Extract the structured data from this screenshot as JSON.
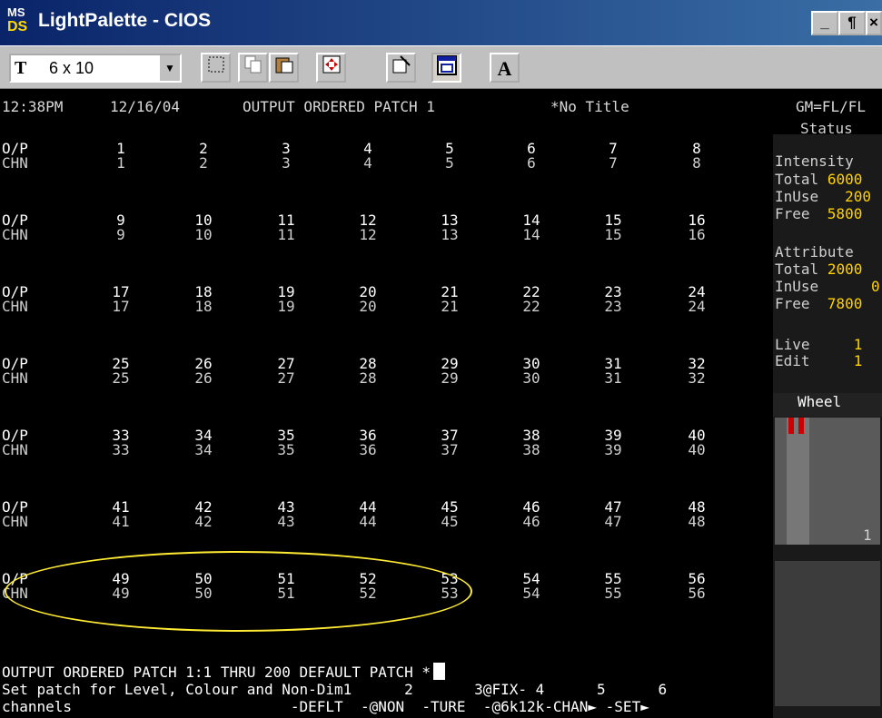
{
  "window": {
    "title": "LightPalette - CIOS",
    "icon_top": "MS",
    "icon_bottom": "DS",
    "min_label": "_",
    "max_label": "¶",
    "close_label": "×"
  },
  "toolbar": {
    "font_size": "6 x 10",
    "font_glyph": "T",
    "font_dropdown": "▼",
    "a_label": "A"
  },
  "header": {
    "time": "12:38PM",
    "date": "12/16/04",
    "mode": "OUTPUT ORDERED PATCH 1",
    "title": "*No Title",
    "gm": "GM=FL/FL"
  },
  "row_labels": {
    "op": "O/P",
    "chn": "CHN"
  },
  "patch_rows": [
    [
      "1",
      "2",
      "3",
      "4",
      "5",
      "6",
      "7",
      "8"
    ],
    [
      "9",
      "10",
      "11",
      "12",
      "13",
      "14",
      "15",
      "16"
    ],
    [
      "17",
      "18",
      "19",
      "20",
      "21",
      "22",
      "23",
      "24"
    ],
    [
      "25",
      "26",
      "27",
      "28",
      "29",
      "30",
      "31",
      "32"
    ],
    [
      "33",
      "34",
      "35",
      "36",
      "37",
      "38",
      "39",
      "40"
    ],
    [
      "41",
      "42",
      "43",
      "44",
      "45",
      "46",
      "47",
      "48"
    ],
    [
      "49",
      "50",
      "51",
      "52",
      "53",
      "54",
      "55",
      "56"
    ]
  ],
  "status": {
    "heading": "Status",
    "intensity_label": "Intensity",
    "intensity": [
      {
        "k": "Total",
        "v": "6000"
      },
      {
        "k": "InUse",
        "v": "200"
      },
      {
        "k": "Free",
        "v": "5800"
      }
    ],
    "attribute_label": "Attribute",
    "attribute": [
      {
        "k": "Total",
        "v": "2000"
      },
      {
        "k": "InUse",
        "v": "0"
      },
      {
        "k": "Free",
        "v": "7800"
      }
    ],
    "live_label": "Live",
    "live_value": "1",
    "edit_label": "Edit",
    "edit_value": "1",
    "wheel_label": "Wheel",
    "wheel_value": "1"
  },
  "command": {
    "line1": "OUTPUT ORDERED PATCH 1:1 THRU 200 DEFAULT PATCH *",
    "line2": "Set patch for Level, Colour and Non-Dim1      2       3@FIX- 4      5      6",
    "line3": "channels                         -DEFLT  -@NON  -TURE  -@6k12k-CHAN► -SET►"
  }
}
